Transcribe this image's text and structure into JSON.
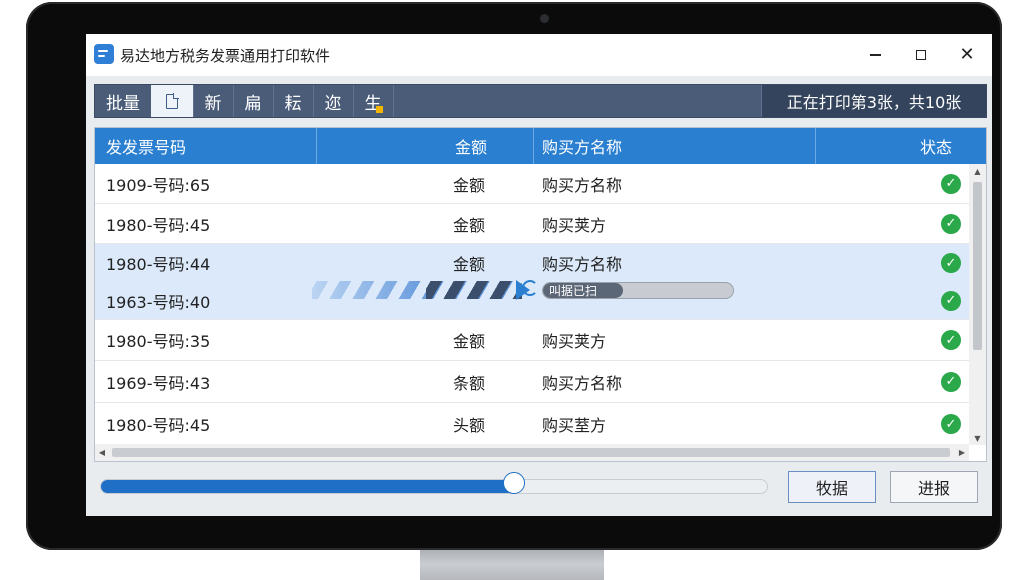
{
  "window": {
    "title": "易达地方税务发票通用打印软件"
  },
  "toolbar": {
    "items": [
      {
        "label": "批量",
        "active": false
      },
      {
        "label": "",
        "icon": "document-icon",
        "active": true
      },
      {
        "label": "新",
        "active": false
      },
      {
        "label": "扁",
        "active": false
      },
      {
        "label": "耘",
        "active": false
      },
      {
        "label": "迩",
        "active": false
      },
      {
        "label": "生",
        "active": false
      }
    ],
    "status": "正在打印第3张，共10张"
  },
  "table": {
    "columns": [
      "发发票号码",
      "金额",
      "购买方名称",
      "状态"
    ],
    "rows": [
      {
        "number": "1909-号码:65",
        "amount": "金额",
        "buyer": "购买方名称",
        "status": "done"
      },
      {
        "number": "1980-号码:45",
        "amount": "金额",
        "buyer": "购买荚方",
        "status": "done"
      },
      {
        "number": "1980-号码:44",
        "amount": "金额",
        "buyer": "购买方名称",
        "status": "done"
      },
      {
        "number": "1963-号码:40",
        "amount": "",
        "buyer": "",
        "status": "done"
      },
      {
        "number": "1980-号码:35",
        "amount": "金额",
        "buyer": "购买荚方",
        "status": "done"
      },
      {
        "number": "1969-号码:43",
        "amount": "条额",
        "buyer": "购买方名称",
        "status": "done"
      },
      {
        "number": "1980-号码:45",
        "amount": "头额",
        "buyer": "购买荎方",
        "status": "done"
      }
    ],
    "row_progress": {
      "text": "叫据已扫",
      "fraction": 0.42
    }
  },
  "footer": {
    "progress_fraction": 0.62,
    "button_1": "牧据",
    "button_2": "进报"
  },
  "colors": {
    "header_blue": "#2a7fd0",
    "toolbar": "#4a5c78",
    "check_green": "#2aa84a",
    "slider_blue": "#1f6fc6"
  }
}
